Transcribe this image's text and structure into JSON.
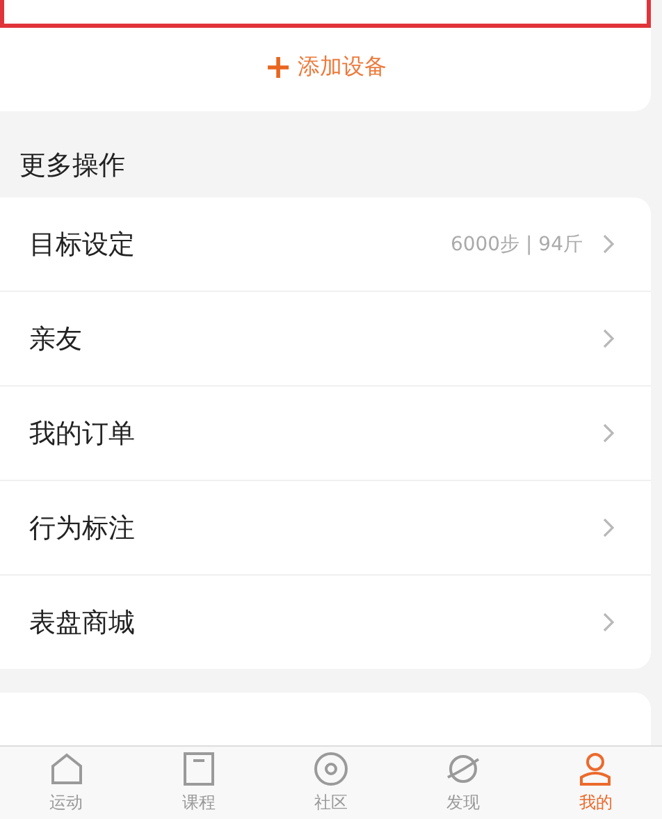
{
  "add_device": {
    "icon": "+",
    "label": "添加设备"
  },
  "section_title": "更多操作",
  "menu": [
    {
      "label": "目标设定",
      "value": "6000步 | 94斤"
    },
    {
      "label": "亲友"
    },
    {
      "label": "我的订单"
    },
    {
      "label": "行为标注"
    },
    {
      "label": "表盘商城"
    }
  ],
  "tab_bar": [
    {
      "label": "运动",
      "kind": "home",
      "selected": false
    },
    {
      "label": "课程",
      "kind": "course",
      "selected": false
    },
    {
      "label": "社区",
      "kind": "community",
      "selected": false
    },
    {
      "label": "发现",
      "kind": "discover",
      "selected": false
    },
    {
      "label": "我的",
      "kind": "me",
      "selected": true
    }
  ]
}
